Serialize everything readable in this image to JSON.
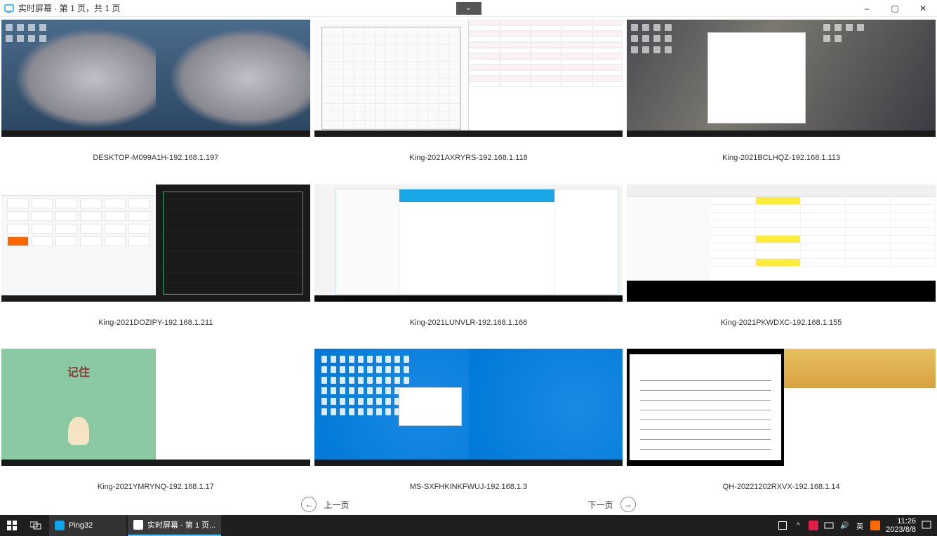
{
  "window": {
    "title": "实时屏幕 · 第 1 页，共 1 页",
    "minimize": "–",
    "maximize": "▢",
    "close": "✕",
    "dropdown": "⌄"
  },
  "screens": [
    {
      "label": "DESKTOP-M099A1H-192.168.1.197"
    },
    {
      "label": "King-2021AXRYRS-192.168.1.118"
    },
    {
      "label": "King-2021BCLHQZ-192.168.1.113"
    },
    {
      "label": "King-2021DOZIPY-192.168.1.211"
    },
    {
      "label": "King-2021LUNVLR-192.168.1.166"
    },
    {
      "label": "King-2021PKWDXC-192.168.1.155"
    },
    {
      "label": "King-2021YMRYNQ-192.168.1.17"
    },
    {
      "label": "MS-SXFHKINKFWUJ-192.168.1.3"
    },
    {
      "label": "QH-20221202RXVX-192.168.1.14"
    }
  ],
  "pager": {
    "prev": "上一页",
    "next": "下一页"
  },
  "taskbar": {
    "app1": "Ping32",
    "app2": "实时屏幕 - 第 1 页...",
    "ime": "英",
    "time": "11:26",
    "date": "2023/8/8"
  },
  "thumb7": {
    "heading": "记住"
  }
}
